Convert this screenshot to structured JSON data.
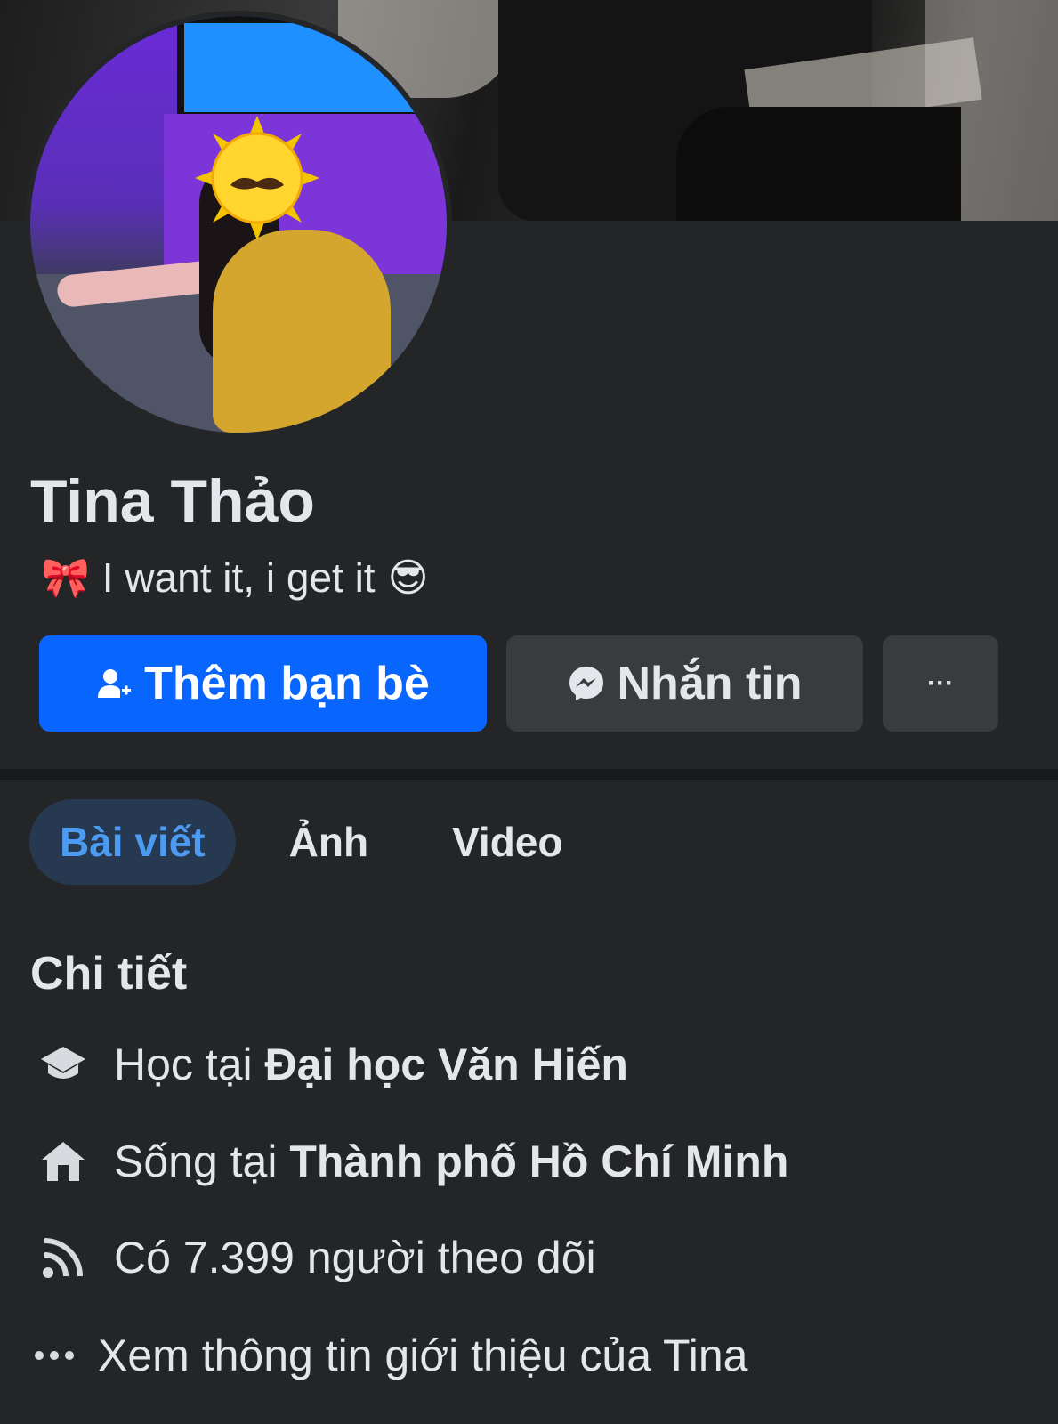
{
  "profile": {
    "name": "Tina Thảo",
    "bio_emoji_left": "🎀",
    "bio": "I want it, i get it",
    "bio_emoji_right": "😎"
  },
  "actions": {
    "add_friend": "Thêm bạn bè",
    "message": "Nhắn tin",
    "more": "···"
  },
  "tabs": [
    {
      "label": "Bài viết",
      "active": true
    },
    {
      "label": "Ảnh",
      "active": false
    },
    {
      "label": "Video",
      "active": false
    }
  ],
  "details": {
    "title": "Chi tiết",
    "education": {
      "prefix": "Học tại ",
      "value": "Đại học Văn Hiến",
      "icon": "graduation-cap-icon"
    },
    "residence": {
      "prefix": "Sống tại ",
      "value": "Thành phố Hồ Chí Minh",
      "icon": "home-icon"
    },
    "followers": {
      "text": "Có 7.399 người theo dõi",
      "icon": "rss-feed-icon"
    },
    "about": {
      "text": "Xem thông tin giới thiệu của Tina",
      "icon": "more-dots-icon"
    }
  },
  "colors": {
    "background": "#242526",
    "primary_button": "#0866ff",
    "secondary_button": "#3a3b3c",
    "active_tab_bg": "#263951",
    "active_tab_text": "#4c9bf3"
  }
}
